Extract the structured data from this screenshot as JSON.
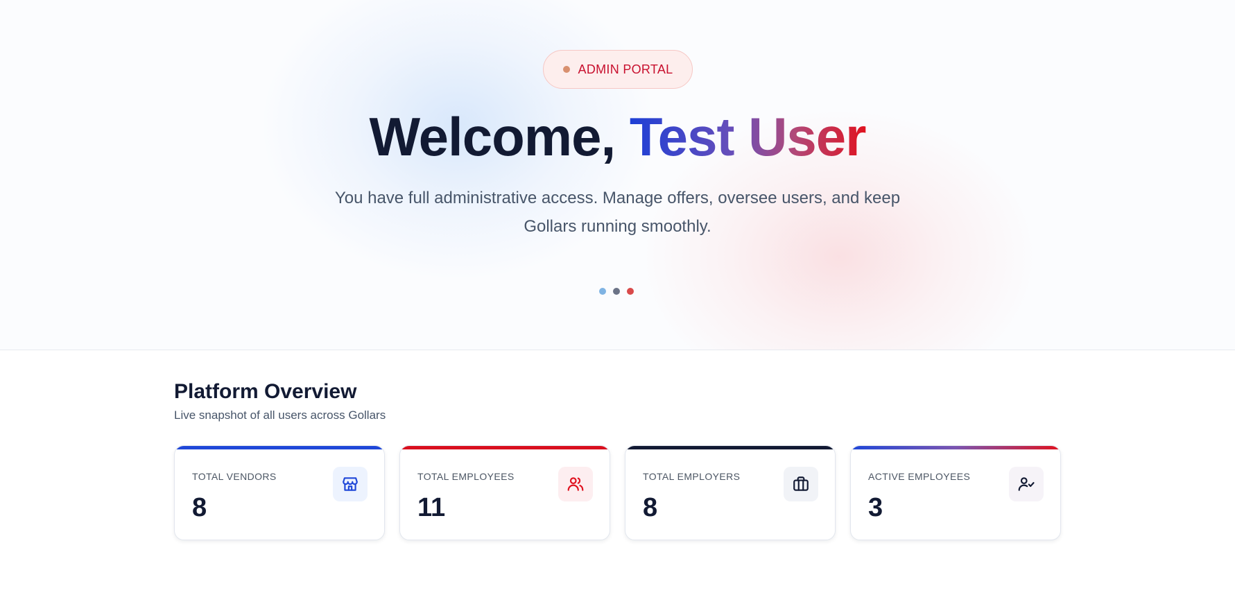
{
  "hero": {
    "badge": "ADMIN PORTAL",
    "title_greeting": "Welcome, ",
    "title_name": "Test User",
    "subtitle_line1": "You have full administrative access. Manage offers, oversee users, and keep",
    "subtitle_line2": "Gollars running smoothly.",
    "carousel": {
      "dots": [
        "#7fb3e3",
        "#6b7387",
        "#d94a4a"
      ]
    }
  },
  "overview": {
    "title": "Platform Overview",
    "subtitle": "Live snapshot of all users across Gollars",
    "cards": [
      {
        "label": "TOTAL VENDORS",
        "value": "8",
        "icon": "store-icon",
        "accent": "#1f47d8",
        "icon_color": "#1f47d8",
        "icon_bg": "#edf3fe"
      },
      {
        "label": "TOTAL EMPLOYEES",
        "value": "11",
        "icon": "users-icon",
        "accent": "#d90f1e",
        "icon_color": "#e0121f",
        "icon_bg": "#fdeef0"
      },
      {
        "label": "TOTAL EMPLOYERS",
        "value": "8",
        "icon": "briefcase-icon",
        "accent": "#121a33",
        "icon_color": "#121a33",
        "icon_bg": "#f1f3f7"
      },
      {
        "label": "ACTIVE EMPLOYEES",
        "value": "3",
        "icon": "user-check-icon",
        "accent": "gradient",
        "icon_color": "#121a33",
        "icon_bg": "#f6f3f8"
      }
    ]
  }
}
